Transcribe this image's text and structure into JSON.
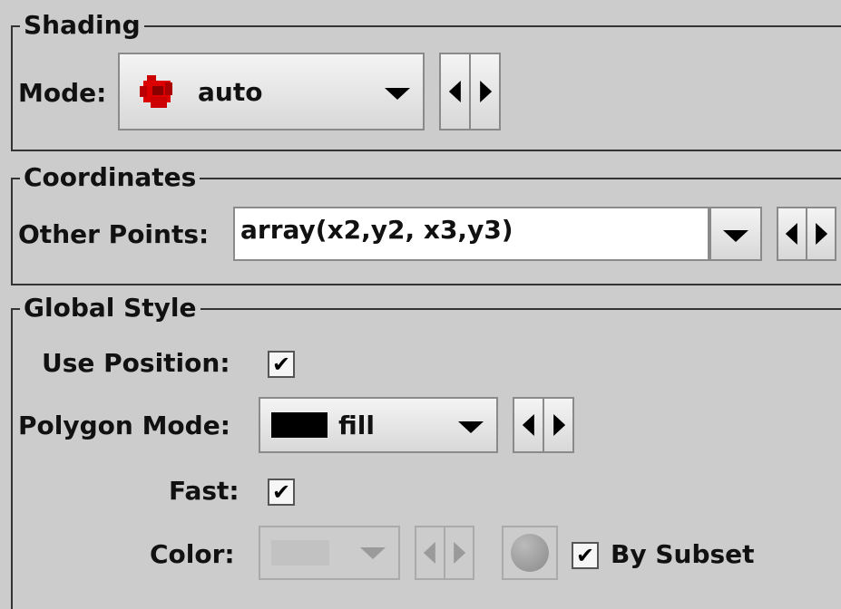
{
  "shading": {
    "title": "Shading",
    "mode_label": "Mode:",
    "mode_value": "auto",
    "mode_icon": "red-blob-icon"
  },
  "coordinates": {
    "title": "Coordinates",
    "other_points_label": "Other Points:",
    "other_points_value": "array(x2,y2, x3,y3)"
  },
  "global_style": {
    "title": "Global Style",
    "use_position_label": "Use Position:",
    "use_position_checked": true,
    "polygon_mode_label": "Polygon Mode:",
    "polygon_mode_value": "fill",
    "polygon_mode_icon": "black-rectangle-icon",
    "fast_label": "Fast:",
    "fast_checked": true,
    "color_label": "Color:",
    "color_enabled": false,
    "by_subset_label": "By Subset",
    "by_subset_checked": true
  },
  "check_glyph": "✔",
  "colors": {
    "background": "#cccccc",
    "shading_icon": "#dd0000",
    "polygon_icon": "#000000",
    "disabled": "#9a9a9a"
  }
}
